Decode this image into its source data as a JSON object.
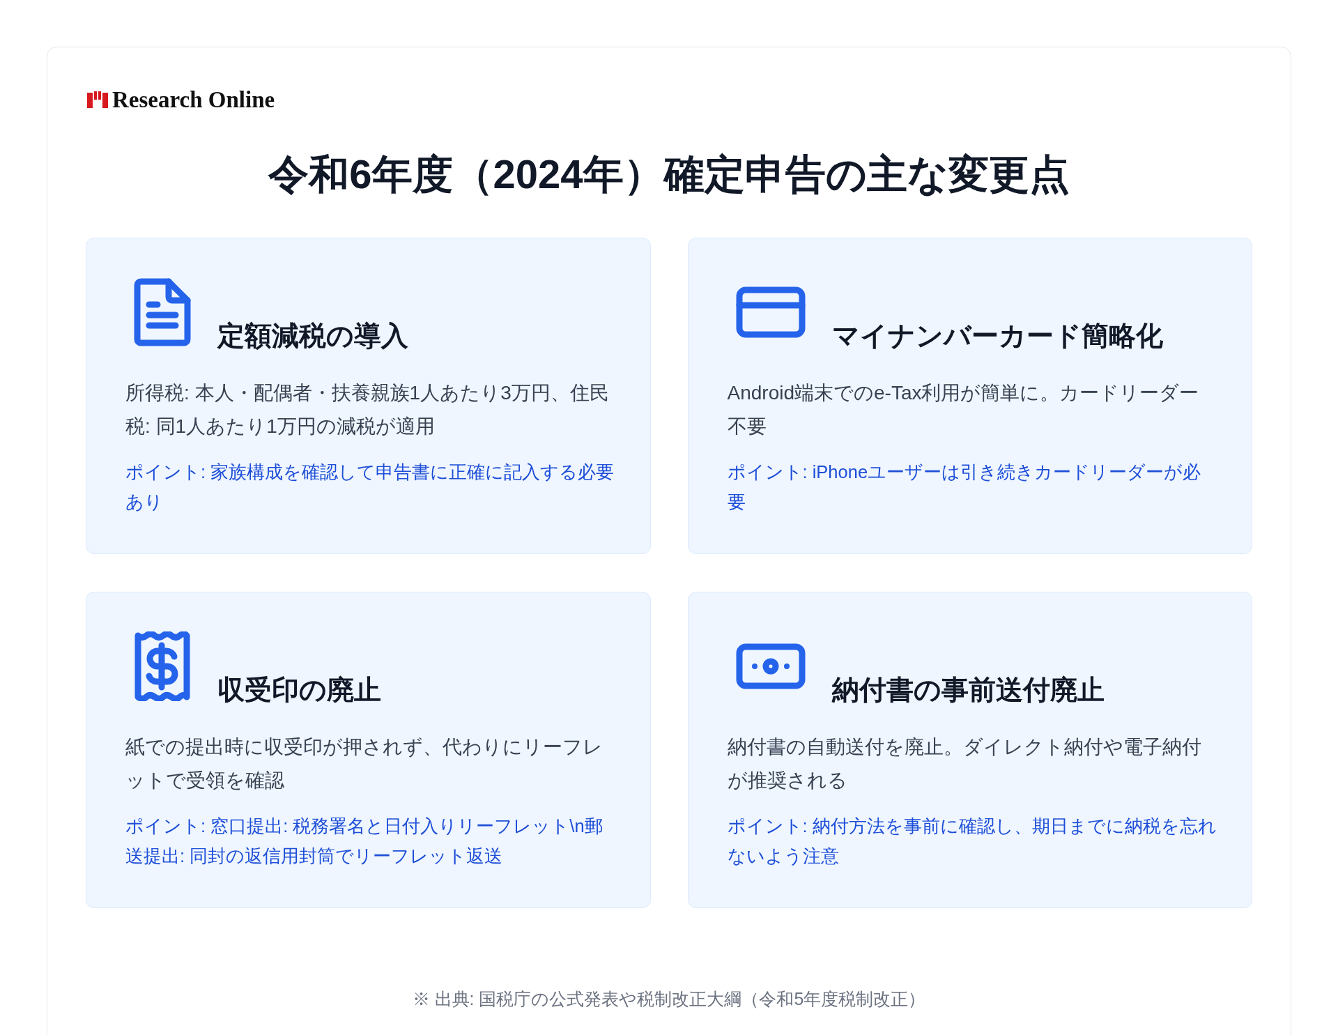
{
  "logo": {
    "text": "Research Online"
  },
  "title": "令和6年度（2024年）確定申告の主な変更点",
  "cards": [
    {
      "kind": "document",
      "title": "定額減税の導入",
      "body": "所得税: 本人・配偶者・扶養親族1人あたり3万円、住民税: 同1人あたり1万円の減税が適用",
      "point": "ポイント: 家族構成を確認して申告書に正確に記入する必要あり"
    },
    {
      "kind": "card",
      "title": "マイナンバーカード簡略化",
      "body": "Android端末でのe-Tax利用が簡単に。カードリーダー不要",
      "point": "ポイント: iPhoneユーザーは引き続きカードリーダーが必要"
    },
    {
      "kind": "receipt",
      "title": "収受印の廃止",
      "body": "紙での提出時に収受印が押されず、代わりにリーフレットで受領を確認",
      "point": "ポイント: 窓口提出: 税務署名と日付入りリーフレット\\n郵送提出: 同封の返信用封筒でリーフレット返送"
    },
    {
      "kind": "money",
      "title": "納付書の事前送付廃止",
      "body": "納付書の自動送付を廃止。ダイレクト納付や電子納付が推奨される",
      "point": "ポイント: 納付方法を事前に確認し、期日までに納税を忘れないよう注意"
    }
  ],
  "footnote": "※ 出典: 国税庁の公式発表や税制改正大綱（令和5年度税制改正）"
}
